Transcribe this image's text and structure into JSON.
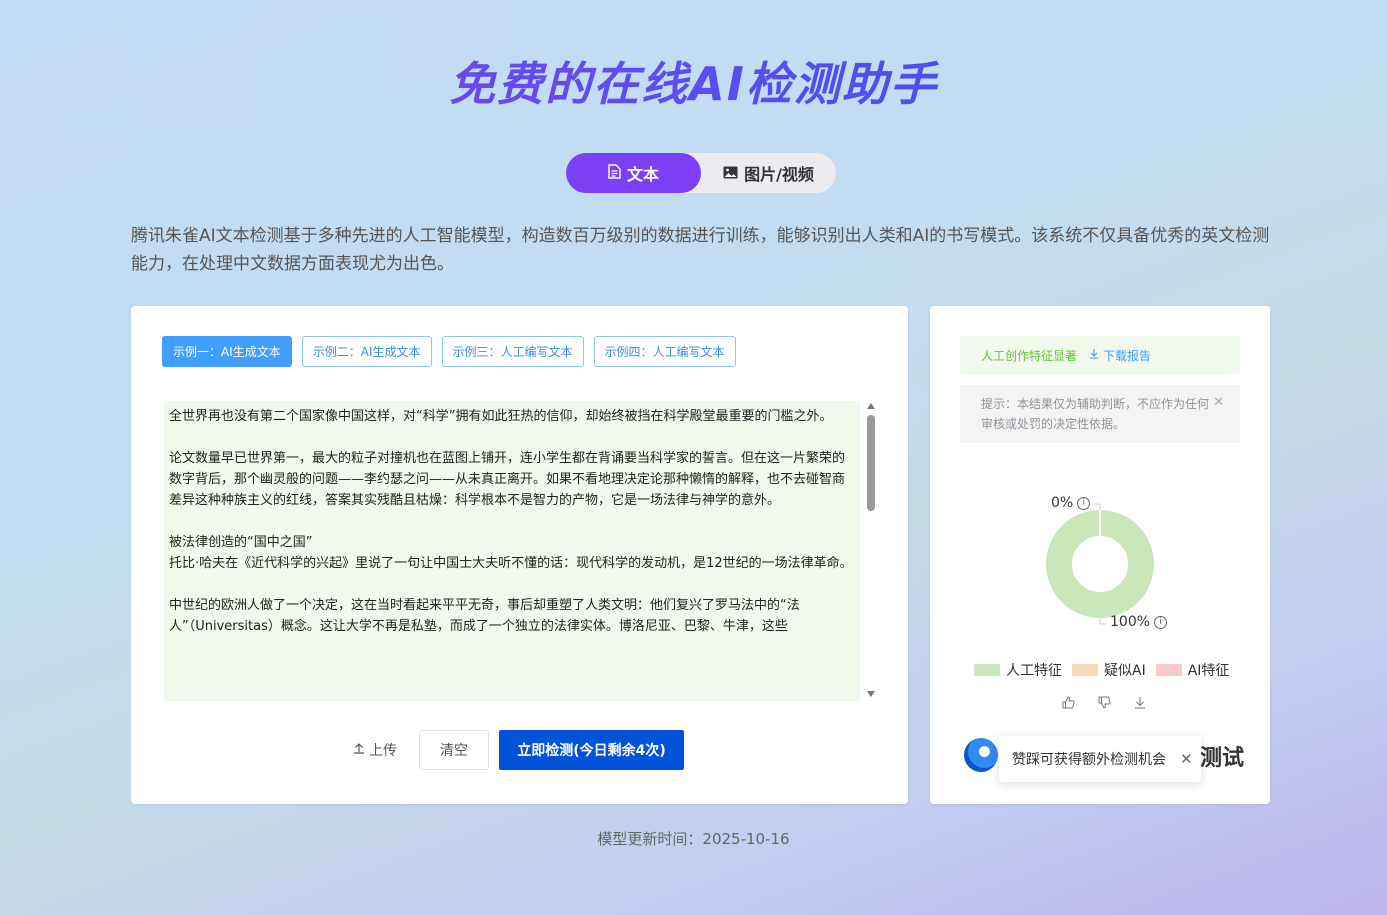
{
  "title": "免费的在线AI检测助手",
  "mode_tabs": [
    {
      "label": "文本",
      "icon": "document-icon",
      "active": true
    },
    {
      "label": "图片/视频",
      "icon": "image-icon",
      "active": false
    }
  ],
  "description": "腾讯朱雀AI文本检测基于多种先进的人工智能模型，构造数百万级别的数据进行训练，能够识别出人类和AI的书写模式。该系统不仅具备优秀的英文检测能力，在处理中文数据方面表现尤为出色。",
  "examples": [
    {
      "label": "示例一：AI生成文本",
      "active": true
    },
    {
      "label": "示例二：AI生成文本",
      "active": false
    },
    {
      "label": "示例三：人工编写文本",
      "active": false
    },
    {
      "label": "示例四：人工编写文本",
      "active": false
    }
  ],
  "input_text": {
    "p1": "全世界再也没有第二个国家像中国这样，对“科学”拥有如此狂热的信仰，却始终被挡在科学殿堂最重要的门槛之外。",
    "p2": "论文数量早已世界第一，最大的粒子对撞机也在蓝图上铺开，连小学生都在背诵要当科学家的誓言。但在这一片繁荣的数字背后，那个幽灵般的问题——李约瑟之问——从未真正离开。如果不看地理决定论那种懒惰的解释，也不去碰智商差异这种种族主义的红线，答案其实残酷且枯燥：科学根本不是智力的产物，它是一场法律与神学的意外。",
    "p3a": "被法律创造的“国中之国”",
    "p3b": "托比·哈夫在《近代科学的兴起》里说了一句让中国士大夫听不懂的话：现代科学的发动机，是12世纪的一场法律革命。",
    "p4": "中世纪的欧洲人做了一个决定，这在当时看起来平平无奇，事后却重塑了人类文明：他们复兴了罗马法中的“法人”（Universitas）概念。这让大学不再是私塾，而成了一个独立的法律实体。博洛尼亚、巴黎、牛津，这些"
  },
  "actions": {
    "upload": "上传",
    "clear": "清空",
    "detect": "立即检测(今日剩余4次)"
  },
  "result": {
    "summary": "人工创作特征显著",
    "download": "下载报告",
    "tip": "提示：本结果仅为辅助判断，不应作为任何审核或处罚的决定性依据。"
  },
  "chart_data": {
    "type": "pie",
    "categories": [
      "人工特征",
      "疑似AI",
      "AI特征"
    ],
    "values": [
      100,
      0,
      0
    ],
    "labels": [
      "0%",
      "100%"
    ],
    "colors": [
      "#c9e7b8",
      "#f8d9b8",
      "#fac8cc"
    ]
  },
  "popup": {
    "text": "赞踩可获得额外检测机会"
  },
  "bottom_partial": "测试",
  "footer": "模型更新时间：2025-10-16",
  "colors": {
    "accent": "#7b3ff5",
    "primary": "#0052d9",
    "link": "#409eff",
    "success": "#67c23a"
  }
}
